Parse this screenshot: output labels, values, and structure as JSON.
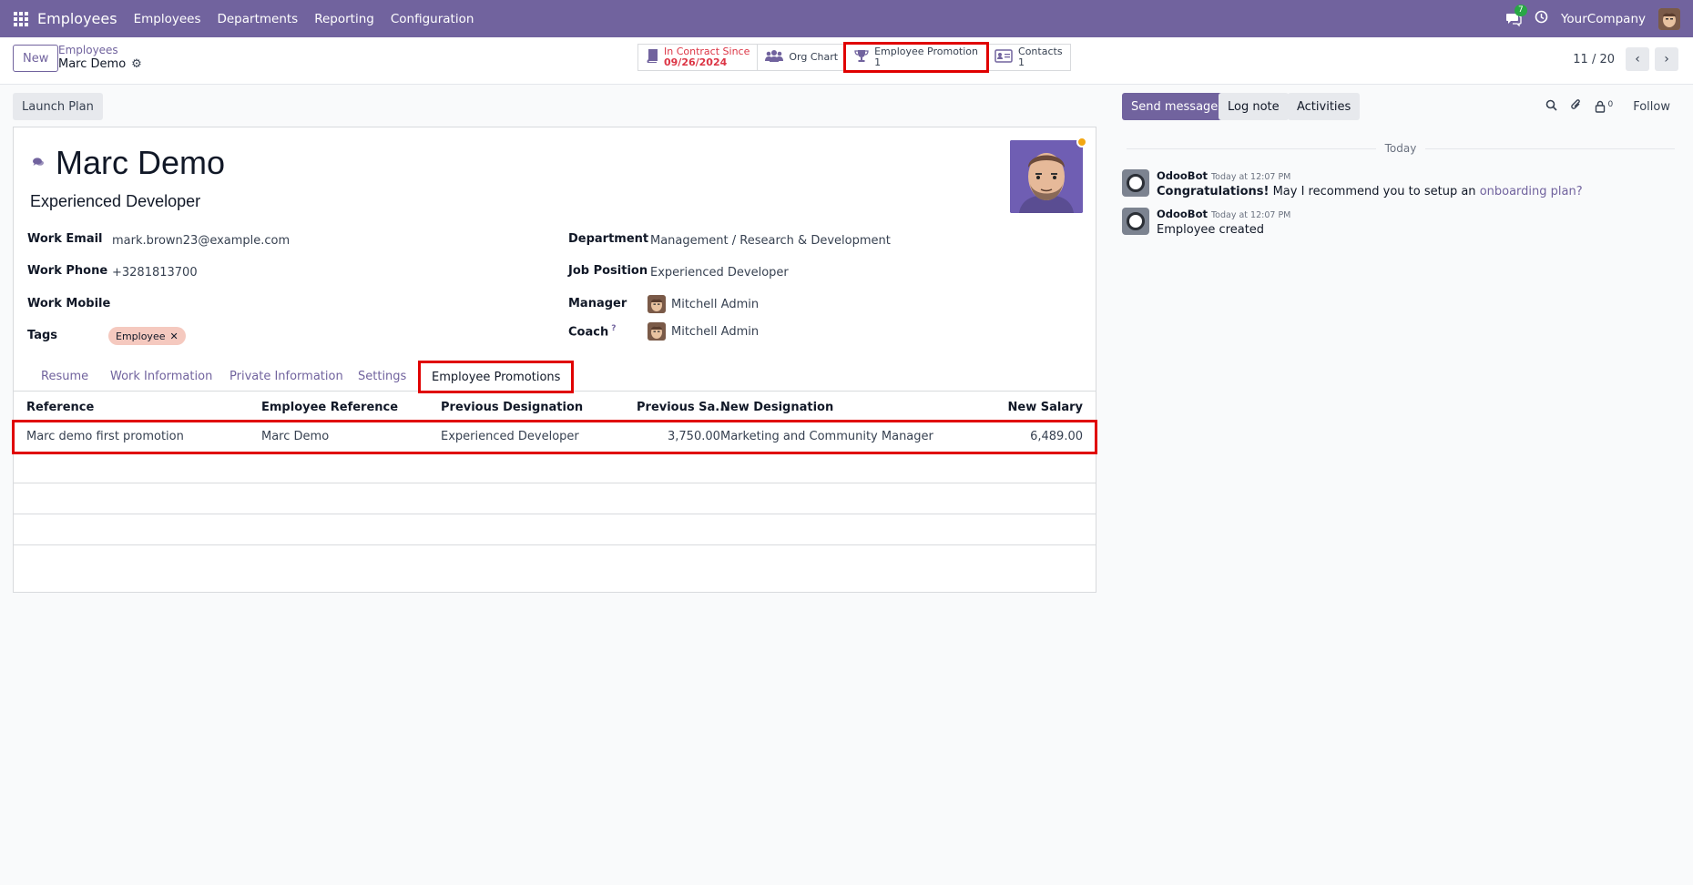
{
  "navbar": {
    "app_title": "Employees",
    "menu": [
      "Employees",
      "Departments",
      "Reporting",
      "Configuration"
    ],
    "messages_badge": "7",
    "company": "YourCompany"
  },
  "control": {
    "new_label": "New",
    "breadcrumb_parent": "Employees",
    "breadcrumb_current": "Marc Demo",
    "pager": "11 / 20"
  },
  "smart_buttons": [
    {
      "label": "In Contract Since",
      "value": "09/26/2024",
      "icon": "book-icon"
    },
    {
      "label": "Org Chart",
      "value": "",
      "icon": "users-icon"
    },
    {
      "label": "Employee Promotion",
      "value": "1",
      "icon": "trophy-icon"
    },
    {
      "label": "Contacts",
      "value": "1",
      "icon": "id-card-icon"
    }
  ],
  "form": {
    "launch_plan_label": "Launch Plan",
    "name": "Marc Demo",
    "job_title": "Experienced Developer",
    "fields_left": [
      {
        "label": "Work Email",
        "value": "mark.brown23@example.com"
      },
      {
        "label": "Work Phone",
        "value": "+3281813700"
      },
      {
        "label": "Work Mobile",
        "value": ""
      },
      {
        "label": "Tags",
        "value": ""
      }
    ],
    "tag": "Employee",
    "fields_right": [
      {
        "label": "Department",
        "value": "Management / Research & Development"
      },
      {
        "label": "Job Position",
        "value": "Experienced Developer"
      },
      {
        "label": "Manager",
        "value": "Mitchell Admin"
      },
      {
        "label": "Coach",
        "value": "Mitchell Admin"
      }
    ],
    "coach_help": "?",
    "tabs": [
      "Resume",
      "Work Information",
      "Private Information",
      "Settings",
      "Employee Promotions"
    ],
    "table": {
      "headers": [
        "Reference",
        "Employee Reference",
        "Previous Designation",
        "Previous Sa...",
        "New Designation",
        "New Salary"
      ],
      "rows": [
        [
          "Marc demo first promotion",
          "Marc Demo",
          "Experienced Developer",
          "3,750.00",
          "Marketing and Community Manager",
          "6,489.00"
        ]
      ]
    }
  },
  "chatter": {
    "send_message": "Send message",
    "log_note": "Log note",
    "activities": "Activities",
    "follower_count": "0",
    "follow": "Follow",
    "date_separator": "Today",
    "messages": [
      {
        "author": "OdooBot",
        "time": "Today at 12:07 PM",
        "bold": "Congratulations!",
        "text": " May I recommend you to setup an ",
        "link": "onboarding plan?"
      },
      {
        "author": "OdooBot",
        "time": "Today at 12:07 PM",
        "bold": "",
        "text": "Employee created",
        "link": ""
      }
    ]
  },
  "colors": {
    "brand": "#71639e",
    "highlight": "#e00000",
    "danger": "#dc3545"
  }
}
